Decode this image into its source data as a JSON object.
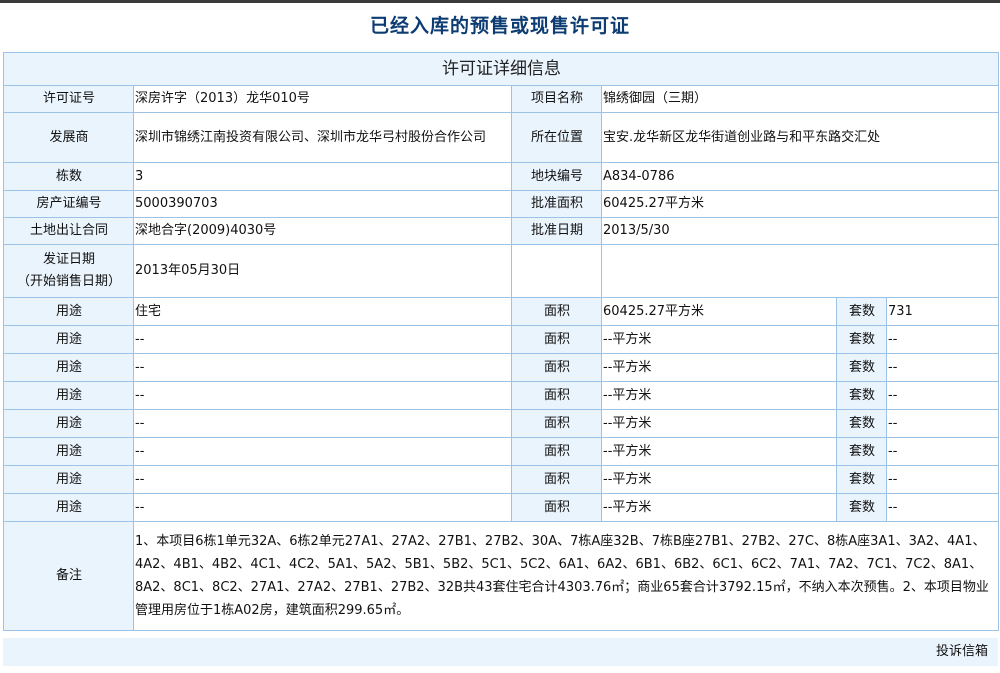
{
  "page": {
    "title": "已经入库的预售或现售许可证"
  },
  "table": {
    "caption": "许可证详细信息",
    "permit_no_label": "许可证号",
    "permit_no": "深房许字（2013）龙华010号",
    "project_label": "项目名称",
    "project": "锦绣御园（三期）",
    "developer_label": "发展商",
    "developer": "深圳市锦绣江南投资有限公司、深圳市龙华弓村股份合作公司",
    "location_label": "所在位置",
    "location": "宝安.龙华新区龙华街道创业路与和平东路交汇处",
    "buildings_label": "栋数",
    "buildings": "3",
    "parcel_label": "地块编号",
    "parcel": "A834-0786",
    "deed_label": "房产证编号",
    "deed": "5000390703",
    "approved_area_label": "批准面积",
    "approved_area": "60425.27平方米",
    "land_contract_label": "土地出让合同",
    "land_contract": "深地合字(2009)4030号",
    "approved_date_label": "批准日期",
    "approved_date": "2013/5/30",
    "issue_date_label_1": "发证日期",
    "issue_date_label_2": "（开始销售日期）",
    "issue_date": "2013年05月30日",
    "usage_rows": [
      {
        "use_label": "用途",
        "use": "住宅",
        "area_label": "面积",
        "area": "60425.27平方米",
        "units_label": "套数",
        "units": "731"
      },
      {
        "use_label": "用途",
        "use": "--",
        "area_label": "面积",
        "area": "--平方米",
        "units_label": "套数",
        "units": "--"
      },
      {
        "use_label": "用途",
        "use": "--",
        "area_label": "面积",
        "area": "--平方米",
        "units_label": "套数",
        "units": "--"
      },
      {
        "use_label": "用途",
        "use": "--",
        "area_label": "面积",
        "area": "--平方米",
        "units_label": "套数",
        "units": "--"
      },
      {
        "use_label": "用途",
        "use": "--",
        "area_label": "面积",
        "area": "--平方米",
        "units_label": "套数",
        "units": "--"
      },
      {
        "use_label": "用途",
        "use": "--",
        "area_label": "面积",
        "area": "--平方米",
        "units_label": "套数",
        "units": "--"
      },
      {
        "use_label": "用途",
        "use": "--",
        "area_label": "面积",
        "area": "--平方米",
        "units_label": "套数",
        "units": "--"
      },
      {
        "use_label": "用途",
        "use": "--",
        "area_label": "面积",
        "area": "--平方米",
        "units_label": "套数",
        "units": "--"
      }
    ],
    "remark_label": "备注",
    "remark": "1、本项目6栋1单元32A、6栋2单元27A1、27A2、27B1、27B2、30A、7栋A座32B、7栋B座27B1、27B2、27C、8栋A座3A1、3A2、4A1、4A2、4B1、4B2、4C1、4C2、5A1、5A2、5B1、5B2、5C1、5C2、6A1、6A2、6B1、6B2、6C1、6C2、7A1、7A2、7C1、7C2、8A1、8A2、8C1、8C2、27A1、27A2、27B1、27B2、32B共43套住宅合计4303.76㎡；商业65套合计3792.15㎡，不纳入本次预售。2、本项目物业管理用房位于1栋A02房，建筑面积299.65㎡。"
  },
  "footer": {
    "complaint": "投诉信箱"
  },
  "colors": {
    "title": "#0d3c73",
    "label_bg": "#eaf4fd",
    "border": "#9cc3e6"
  }
}
